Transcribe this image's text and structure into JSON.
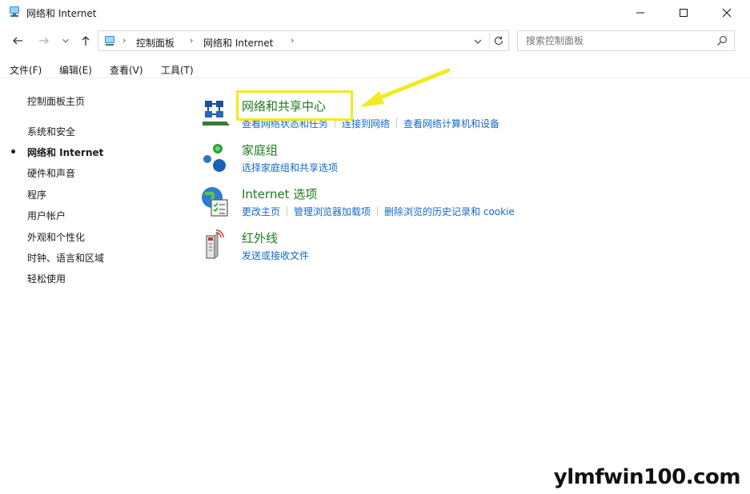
{
  "window": {
    "title": "网络和 Internet",
    "icon": "network-icon"
  },
  "controls": {
    "minimize_icon": "minimize-icon",
    "maximize_icon": "maximize-icon",
    "close_icon": "close-icon"
  },
  "address": {
    "crumbs": [
      "控制面板",
      "网络和 Internet"
    ],
    "separator": "›"
  },
  "search": {
    "placeholder": "搜索控制面板"
  },
  "menu": {
    "items": [
      "文件(F)",
      "编辑(E)",
      "查看(V)",
      "工具(T)"
    ]
  },
  "sidebar": {
    "items": [
      {
        "label": "控制面板主页",
        "current": false
      },
      {
        "label": "系统和安全",
        "current": false
      },
      {
        "label": "网络和 Internet",
        "current": true
      },
      {
        "label": "硬件和声音",
        "current": false
      },
      {
        "label": "程序",
        "current": false
      },
      {
        "label": "用户帐户",
        "current": false
      },
      {
        "label": "外观和个性化",
        "current": false
      },
      {
        "label": "时钟、语言和区域",
        "current": false
      },
      {
        "label": "轻松使用",
        "current": false
      }
    ]
  },
  "categories": [
    {
      "title": "网络和共享中心",
      "icon": "network-sharing-center-icon",
      "links": [
        "查看网络状态和任务",
        "连接到网络",
        "查看网络计算机和设备"
      ]
    },
    {
      "title": "家庭组",
      "icon": "homegroup-icon",
      "links": [
        "选择家庭组和共享选项"
      ]
    },
    {
      "title": "Internet 选项",
      "icon": "internet-options-icon",
      "links": [
        "更改主页",
        "管理浏览器加载项",
        "删除浏览的历史记录和 cookie"
      ]
    },
    {
      "title": "红外线",
      "icon": "infrared-icon",
      "links": [
        "发送或接收文件"
      ]
    }
  ],
  "colors": {
    "category_title": "#1e7a1e",
    "link": "#1569c7",
    "highlight": "#f2ea24"
  },
  "watermark": "ylmfwin100.com"
}
